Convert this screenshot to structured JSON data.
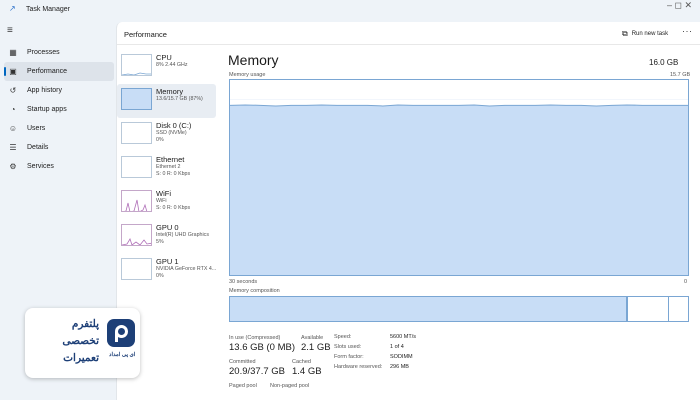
{
  "window": {
    "title": "Task Manager",
    "controls": "– ◻ ✕"
  },
  "nav": {
    "menu_icon": "hamburger-icon",
    "items": [
      {
        "label": "Processes",
        "icon": "processes-icon",
        "glyph": "▦"
      },
      {
        "label": "Performance",
        "icon": "performance-icon",
        "glyph": "▣",
        "active": true
      },
      {
        "label": "App history",
        "icon": "history-icon",
        "glyph": "↺"
      },
      {
        "label": "Startup apps",
        "icon": "startup-icon",
        "glyph": "◔"
      },
      {
        "label": "Users",
        "icon": "users-icon",
        "glyph": "☺"
      },
      {
        "label": "Details",
        "icon": "details-icon",
        "glyph": "☰"
      },
      {
        "label": "Services",
        "icon": "services-icon",
        "glyph": "⚙"
      }
    ]
  },
  "header": {
    "title": "Performance",
    "run_task": "Run new task",
    "more": "···"
  },
  "devices": [
    {
      "name": "CPU",
      "sub1": "8% 2.44 GHz",
      "sub2": "",
      "sub3": ""
    },
    {
      "name": "Memory",
      "sub1": "13.6/15.7 GB (87%)",
      "sub2": "",
      "sub3": "",
      "active": true
    },
    {
      "name": "Disk 0 (C:)",
      "sub1": "SSD (NVMe)",
      "sub2": "0%",
      "sub3": ""
    },
    {
      "name": "Ethernet",
      "sub1": "Ethernet 2",
      "sub2": "S: 0 R: 0 Kbps",
      "sub3": ""
    },
    {
      "name": "WiFi",
      "sub1": "WiFi",
      "sub2": "S: 0 R: 0 Kbps",
      "sub3": ""
    },
    {
      "name": "GPU 0",
      "sub1": "Intel(R) UHD Graphics",
      "sub2": "5%",
      "sub3": ""
    },
    {
      "name": "GPU 1",
      "sub1": "NVIDIA GeForce RTX 4...",
      "sub2": "0%",
      "sub3": ""
    }
  ],
  "memory": {
    "title": "Memory",
    "total": "16.0 GB",
    "usage_label": "Memory usage",
    "usage_max": "15.7 GB",
    "time_label": "30 seconds",
    "time_zero": "0",
    "usage_fraction": 0.87,
    "composition_label": "Memory composition",
    "graph_color": "#c8ddf6",
    "graph_line": "#7aa6d3"
  },
  "stats": {
    "in_use_label": "In use (Compressed)",
    "in_use_value": "13.6 GB (0 MB)",
    "available_label": "Available",
    "available_value": "2.1 GB",
    "committed_label": "Committed",
    "committed_value": "20.9/37.7 GB",
    "cached_label": "Cached",
    "cached_value": "1.4 GB",
    "paged_label": "Paged pool",
    "nonpaged_label": "Non-paged pool"
  },
  "specs": [
    {
      "key": "Speed:",
      "value": "5600 MT/s"
    },
    {
      "key": "Slots used:",
      "value": "1 of 4"
    },
    {
      "key": "Form factor:",
      "value": "SODIMM"
    },
    {
      "key": "Hardware reserved:",
      "value": "296 MB"
    }
  ],
  "badge": {
    "lines": [
      "پلتفرم",
      "تخصصی",
      "تعمیرات"
    ],
    "subtitle": "ای پی امداد",
    "color": "#1d3f77"
  }
}
